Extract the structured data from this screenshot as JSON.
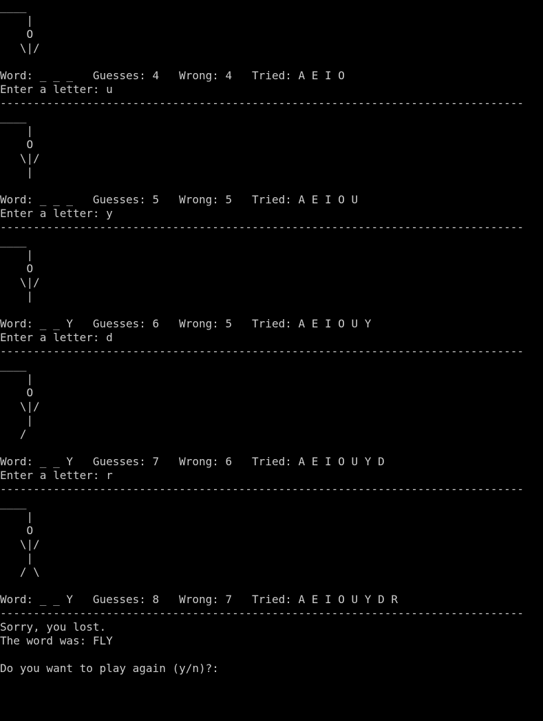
{
  "console": {
    "lines": [
      "____",
      "    |",
      "    O",
      "   \\|/",
      "",
      "Word: _ _ _   Guesses: 4   Wrong: 4   Tried: A E I O",
      "Enter a letter: u",
      "-------------------------------------------------------------------------------",
      "____",
      "    |",
      "    O",
      "   \\|/",
      "    |",
      "",
      "Word: _ _ _   Guesses: 5   Wrong: 5   Tried: A E I O U",
      "Enter a letter: y",
      "-------------------------------------------------------------------------------",
      "____",
      "    |",
      "    O",
      "   \\|/",
      "    |",
      "",
      "Word: _ _ Y   Guesses: 6   Wrong: 5   Tried: A E I O U Y",
      "Enter a letter: d",
      "-------------------------------------------------------------------------------",
      "____",
      "    |",
      "    O",
      "   \\|/",
      "    |",
      "   /",
      "",
      "Word: _ _ Y   Guesses: 7   Wrong: 6   Tried: A E I O U Y D",
      "Enter a letter: r",
      "-------------------------------------------------------------------------------",
      "____",
      "    |",
      "    O",
      "   \\|/",
      "    |",
      "   / \\",
      "",
      "Word: _ _ Y   Guesses: 8   Wrong: 7   Tried: A E I O U Y D R",
      "-------------------------------------------------------------------------------",
      "Sorry, you lost.",
      "The word was: FLY",
      "",
      "Do you want to play again (y/n)?: "
    ]
  },
  "colors": {
    "background": "#000000",
    "text": "#cccccc"
  }
}
